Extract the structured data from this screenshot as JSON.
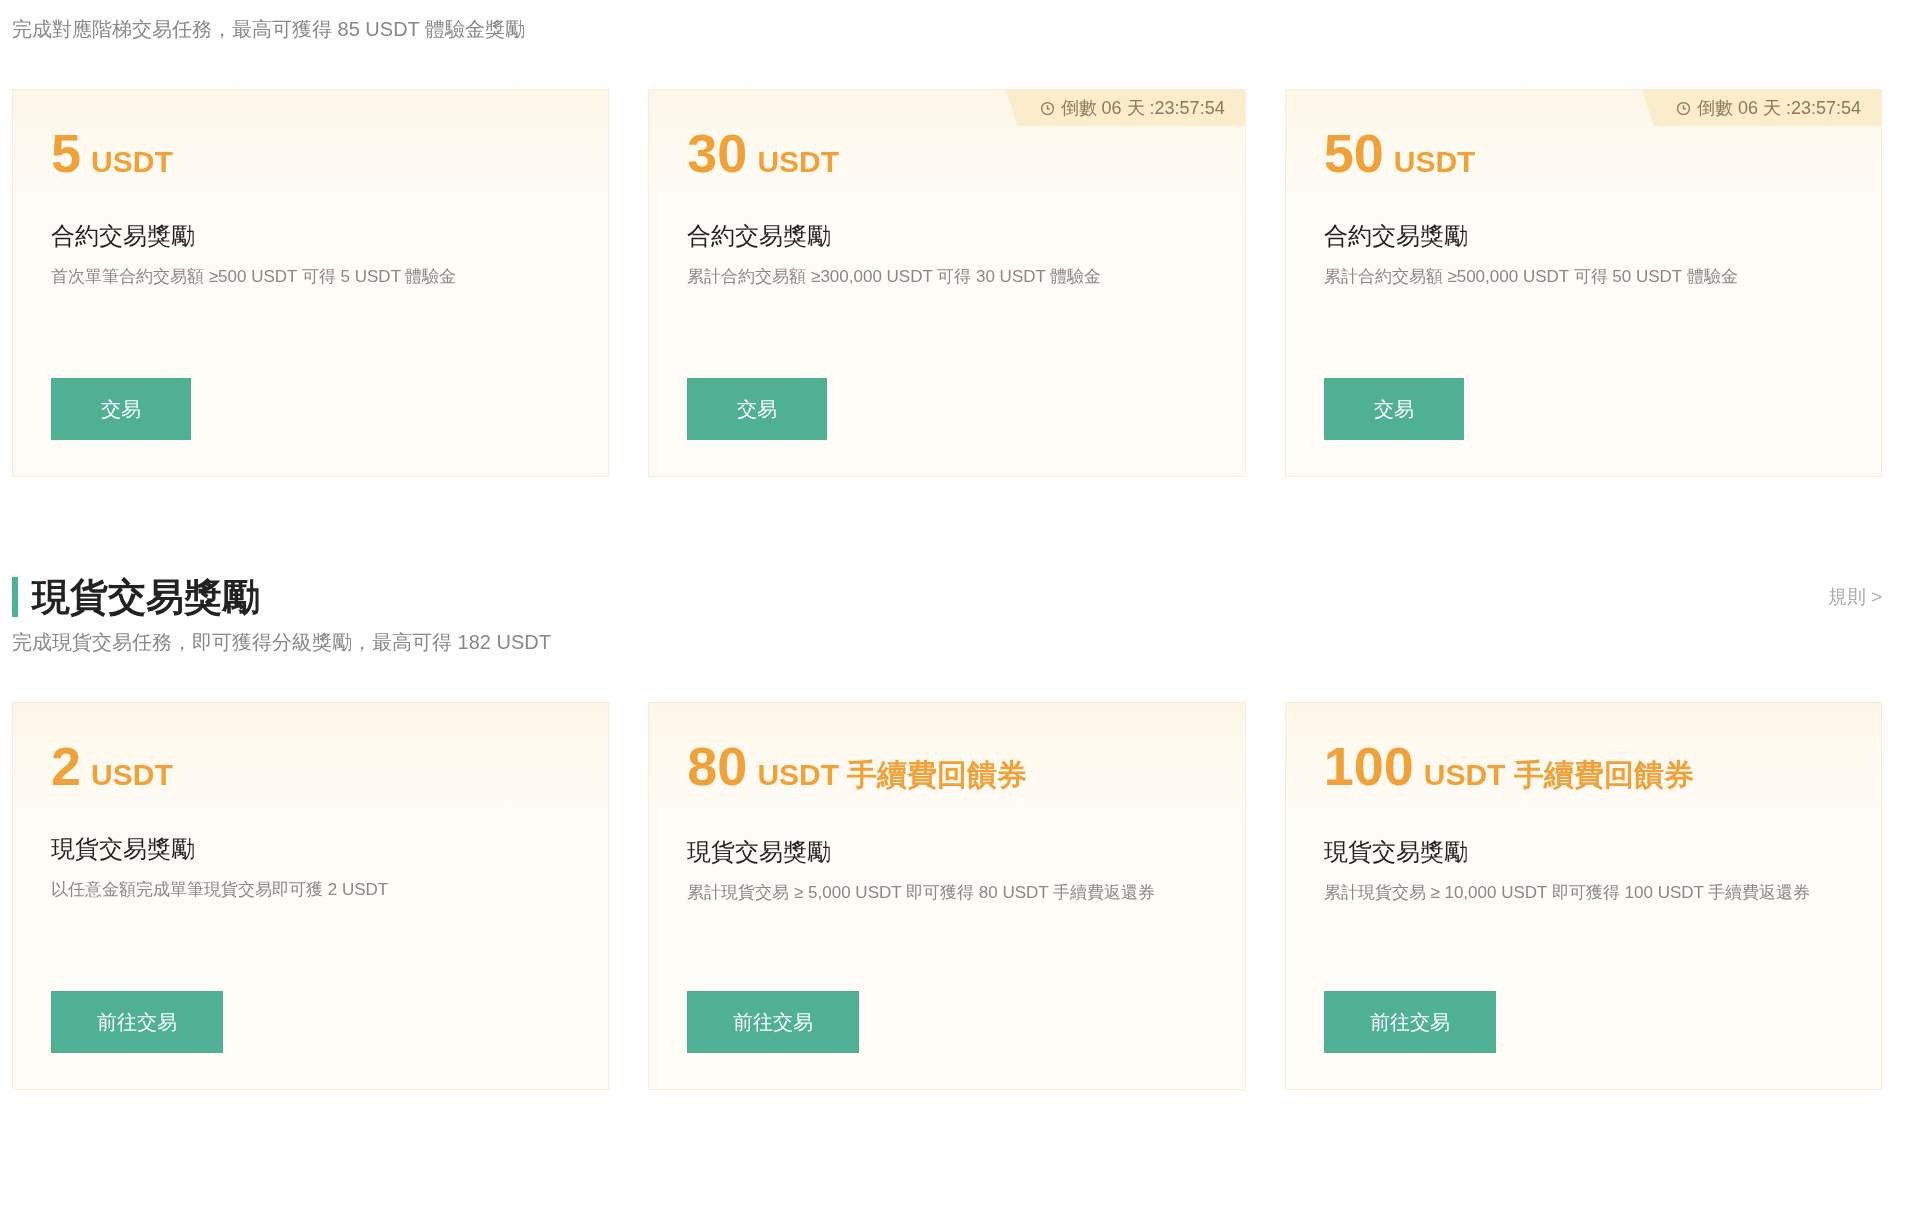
{
  "sections": [
    {
      "subtitle": "完成對應階梯交易任務，最高可獲得 85 USDT 體驗金獎勵",
      "cards": [
        {
          "amount": "5",
          "unit": "USDT",
          "title": "合約交易獎勵",
          "description": "首次單筆合約交易額 ≥500 USDT 可得 5 USDT 體驗金",
          "button": "交易"
        },
        {
          "amount": "30",
          "unit": "USDT",
          "title": "合約交易獎勵",
          "description": "累計合約交易額 ≥300,000 USDT 可得 30 USDT 體驗金",
          "button": "交易",
          "countdown": "倒數 06 天 :23:57:54"
        },
        {
          "amount": "50",
          "unit": "USDT",
          "title": "合約交易獎勵",
          "description": "累計合約交易額 ≥500,000 USDT 可得 50 USDT 體驗金",
          "button": "交易",
          "countdown": "倒數 06 天 :23:57:54"
        }
      ]
    },
    {
      "title": "現貨交易獎勵",
      "rules_link": "規則 >",
      "subtitle": "完成現貨交易任務，即可獲得分級獎勵，最高可得 182 USDT",
      "cards": [
        {
          "amount": "2",
          "unit": "USDT",
          "title": "現貨交易獎勵",
          "description": "以任意金額完成單筆現貨交易即可獲 2 USDT",
          "button": "前往交易"
        },
        {
          "amount": "80",
          "unit": "USDT 手續費回饋券",
          "title": "現貨交易獎勵",
          "description": "累計現貨交易 ≥ 5,000 USDT 即可獲得 80 USDT 手續費返還券",
          "button": "前往交易"
        },
        {
          "amount": "100",
          "unit": "USDT 手續費回饋券",
          "title": "現貨交易獎勵",
          "description": "累計現貨交易 ≥ 10,000 USDT 即可獲得 100 USDT 手續費返還券",
          "button": "前往交易"
        }
      ]
    }
  ]
}
